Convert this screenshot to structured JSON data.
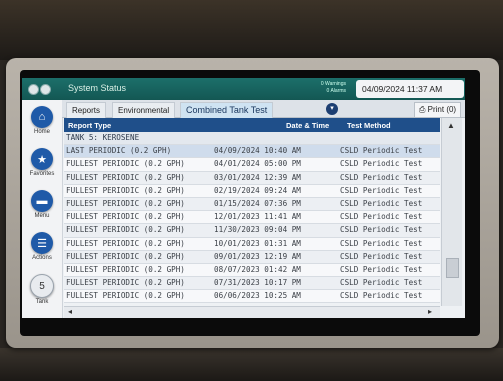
{
  "status_bar": {
    "title": "System Status",
    "warnings": "0 Warnings",
    "alarms": "0 Alarms",
    "datetime": "04/09/2024 11:37 AM"
  },
  "sidebar": {
    "items": [
      {
        "label": "Home",
        "icon": "home-icon"
      },
      {
        "label": "Favorites",
        "icon": "star-icon"
      },
      {
        "label": "Menu",
        "icon": "menu-icon"
      },
      {
        "label": "Actions",
        "icon": "list-icon"
      },
      {
        "label": "Tank",
        "icon": "tank-icon",
        "number": "5"
      }
    ]
  },
  "tabs": {
    "items": [
      "Reports",
      "Environmental",
      "Combined Tank Test"
    ],
    "active": "Combined Tank Test",
    "print_label": "Print (0)"
  },
  "table": {
    "columns": {
      "type": "Report Type",
      "datetime": "Date & Time",
      "method": "Test Method"
    },
    "group": "TANK 5: KEROSENE",
    "rows": [
      {
        "type": "LAST PERIODIC (0.2 GPH)",
        "datetime": "04/09/2024 10:40 AM",
        "method": "CSLD Periodic Test"
      },
      {
        "type": "FULLEST PERIODIC (0.2 GPH)",
        "datetime": "04/01/2024 05:00 PM",
        "method": "CSLD Periodic Test"
      },
      {
        "type": "FULLEST PERIODIC (0.2 GPH)",
        "datetime": "03/01/2024 12:39 AM",
        "method": "CSLD Periodic Test"
      },
      {
        "type": "FULLEST PERIODIC (0.2 GPH)",
        "datetime": "02/19/2024 09:24 AM",
        "method": "CSLD Periodic Test"
      },
      {
        "type": "FULLEST PERIODIC (0.2 GPH)",
        "datetime": "01/15/2024 07:36 PM",
        "method": "CSLD Periodic Test"
      },
      {
        "type": "FULLEST PERIODIC (0.2 GPH)",
        "datetime": "12/01/2023 11:41 AM",
        "method": "CSLD Periodic Test"
      },
      {
        "type": "FULLEST PERIODIC (0.2 GPH)",
        "datetime": "11/30/2023 09:04 PM",
        "method": "CSLD Periodic Test"
      },
      {
        "type": "FULLEST PERIODIC (0.2 GPH)",
        "datetime": "10/01/2023 01:31 AM",
        "method": "CSLD Periodic Test"
      },
      {
        "type": "FULLEST PERIODIC (0.2 GPH)",
        "datetime": "09/01/2023 12:19 AM",
        "method": "CSLD Periodic Test"
      },
      {
        "type": "FULLEST PERIODIC (0.2 GPH)",
        "datetime": "08/07/2023 01:42 AM",
        "method": "CSLD Periodic Test"
      },
      {
        "type": "FULLEST PERIODIC (0.2 GPH)",
        "datetime": "07/31/2023 10:17 PM",
        "method": "CSLD Periodic Test"
      },
      {
        "type": "FULLEST PERIODIC (0.2 GPH)",
        "datetime": "06/06/2023 10:25 AM",
        "method": "CSLD Periodic Test"
      }
    ]
  },
  "colors": {
    "status_bar": "#135753",
    "header": "#1f4f8a",
    "accent": "#1f5aa8"
  }
}
